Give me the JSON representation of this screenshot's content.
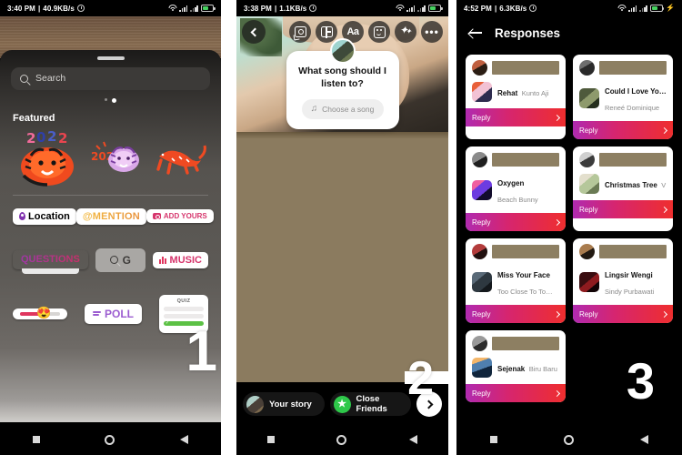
{
  "panel1": {
    "status": {
      "time": "3:40 PM",
      "net_speed": "40.9KB/s",
      "battery_level": "60"
    },
    "photo_alt": "story-preview-blurred",
    "search": {
      "placeholder": "Search",
      "value": ""
    },
    "page_dots": {
      "count": 2,
      "active_index": 1
    },
    "featured_label": "Featured",
    "featured_stickers": [
      {
        "name": "tiger-2022-orange-sticker",
        "label": "2022"
      },
      {
        "name": "tiger-2022-purple-sticker",
        "label": "2022"
      },
      {
        "name": "tiger-running-orange-sticker",
        "label": ""
      }
    ],
    "sticker_rows": [
      [
        {
          "key": "location",
          "label": "Location"
        },
        {
          "key": "mention",
          "label": "@MENTION"
        },
        {
          "key": "add-yours",
          "label": "ADD YOURS"
        }
      ],
      [
        {
          "key": "questions",
          "label": "QUESTIONS"
        },
        {
          "key": "gif",
          "label": "G"
        },
        {
          "key": "music",
          "label": "MUSIC"
        }
      ],
      [
        {
          "key": "slider",
          "label": ""
        },
        {
          "key": "poll",
          "label": "POLL"
        },
        {
          "key": "quiz",
          "label": "QUIZ"
        }
      ]
    ],
    "step_number": "1"
  },
  "panel2": {
    "status": {
      "time": "3:38 PM",
      "net_speed": "1.1KB/s",
      "battery_level": "60"
    },
    "toolbar": [
      {
        "name": "back-button",
        "icon": "chevron-left-icon"
      },
      {
        "name": "sticker-button",
        "icon": "sticker-person-icon"
      },
      {
        "name": "layout-button",
        "icon": "layout-icon"
      },
      {
        "name": "text-button",
        "icon": "aa-text-icon",
        "label": "Aa"
      },
      {
        "name": "emoji-sticker-button",
        "icon": "smiley-sticker-icon"
      },
      {
        "name": "effects-button",
        "icon": "sparkle-icon"
      },
      {
        "name": "more-button",
        "icon": "ellipsis-icon",
        "label": "•••"
      }
    ],
    "music_sticker": {
      "question": "What song should I listen to?",
      "button_label": "Choose a song",
      "button_icon": "music-note-icon"
    },
    "footer": {
      "your_story": "Your story",
      "close_friends": "Close Friends",
      "next_icon": "chevron-right-icon"
    },
    "step_number": "2"
  },
  "panel3": {
    "status": {
      "time": "4:52 PM",
      "net_speed": "6.3KB/s",
      "battery_level": "60",
      "charging": true
    },
    "header": {
      "back_icon": "arrow-left-icon",
      "title": "Responses"
    },
    "reply_label": "Reply",
    "cards": [
      {
        "avatar": "av-a",
        "art": "art-a",
        "song": "Rehat",
        "artist": "Kunto Aji",
        "redacted": true
      },
      {
        "avatar": "av-b",
        "art": "art-b",
        "song": "Could I Love Yo…",
        "artist": "Reneé Dominique",
        "redacted": true
      },
      {
        "avatar": "av-c",
        "art": "art-c",
        "song": "Oxygen",
        "artist": "Beach Bunny",
        "redacted": true
      },
      {
        "avatar": "av-d",
        "art": "art-d",
        "song": "Christmas Tree",
        "artist": "V",
        "redacted": true
      },
      {
        "avatar": "av-e",
        "art": "art-e",
        "song": "Miss Your Face",
        "artist": "Too Close To To…",
        "redacted": true
      },
      {
        "avatar": "av-f",
        "art": "art-f",
        "song": "Lingsir Wengi",
        "artist": "Sindy Purbawati",
        "redacted": true
      },
      {
        "avatar": "av-g",
        "art": "art-g",
        "song": "Sejenak",
        "artist": "Biru Baru",
        "redacted": true
      }
    ],
    "step_number": "3"
  },
  "colors": {
    "reply_gradient_start": "#b02ab0",
    "reply_gradient_mid": "#d6256f",
    "reply_gradient_end": "#ef2e2e",
    "redaction": "#8d7f62",
    "khaki": "#8b7b5f",
    "battery_green": "#46d160"
  }
}
